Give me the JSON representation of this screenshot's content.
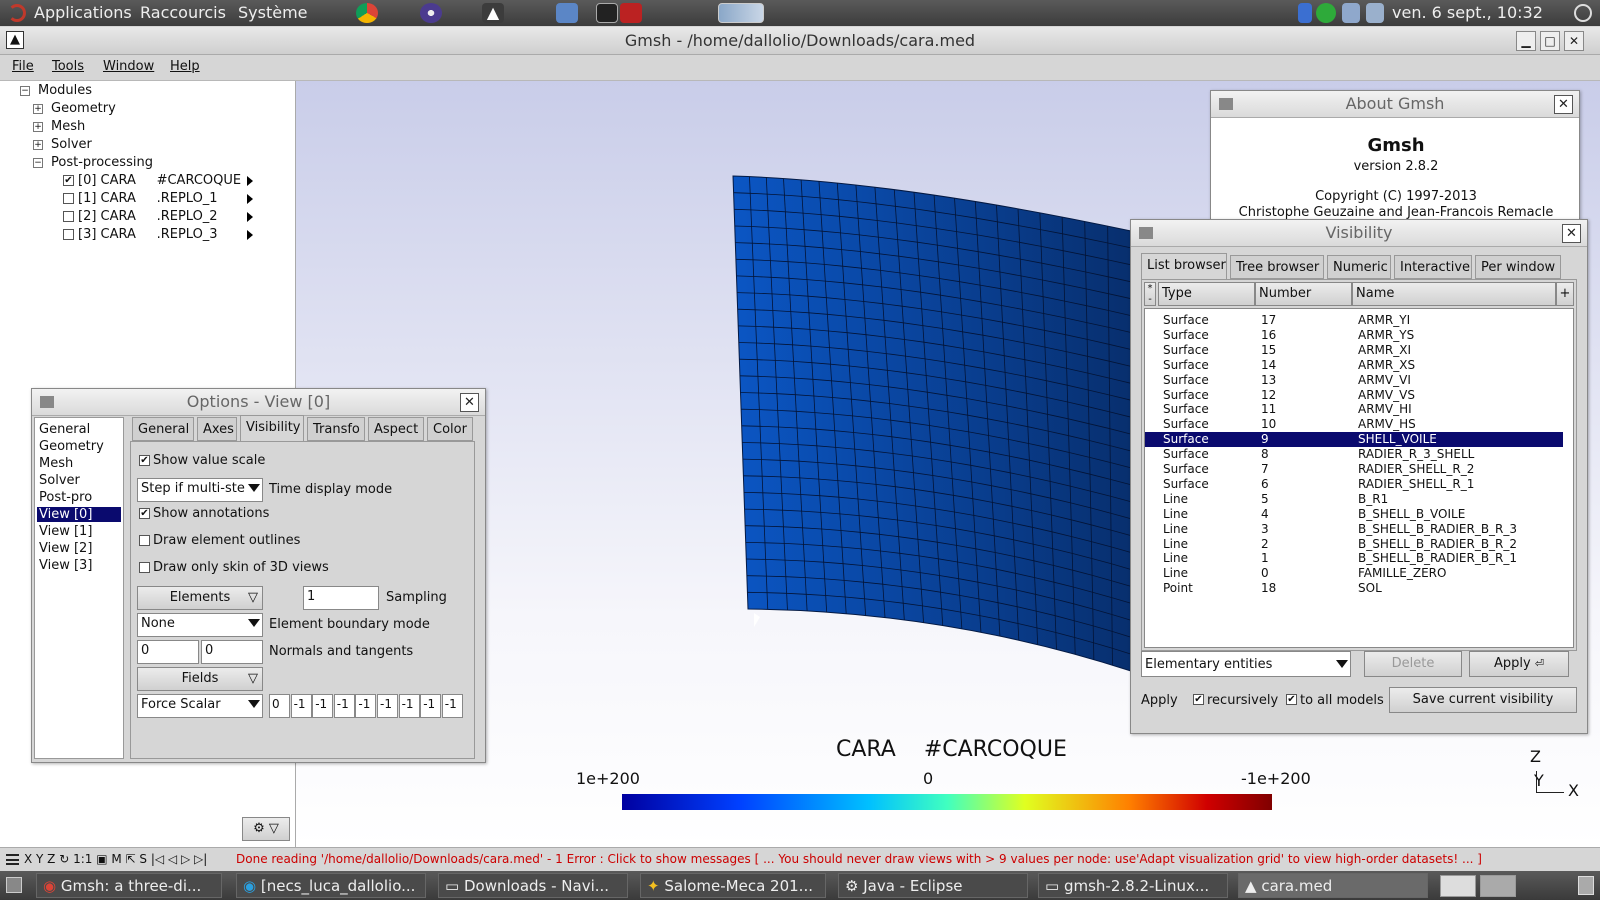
{
  "top_panel": {
    "applications": "Applications",
    "shortcuts": "Raccourcis",
    "system": "Système",
    "clock": "ven.  6 sept., 10:32"
  },
  "window": {
    "title": "Gmsh - /home/dallolio/Downloads/cara.med"
  },
  "menu": {
    "file": "File",
    "tools": "Tools",
    "window": "Window",
    "help": "Help"
  },
  "tree": {
    "modules": "Modules",
    "geometry": "Geometry",
    "mesh": "Mesh",
    "solver": "Solver",
    "postpro": "Post-processing",
    "views": [
      {
        "label": "[0] CARA     #CARCOQUE",
        "checked": true
      },
      {
        "label": "[1] CARA     .REPLO_1",
        "checked": false
      },
      {
        "label": "[2] CARA     .REPLO_2",
        "checked": false
      },
      {
        "label": "[3] CARA     .REPLO_3",
        "checked": false
      }
    ]
  },
  "about": {
    "title": "About Gmsh",
    "app": "Gmsh",
    "version": "version 2.8.2",
    "copyright": "Copyright (C) 1997-2013",
    "authors": "Christophe Geuzaine and Jean-Francois Remacle"
  },
  "options": {
    "title": "Options - View [0]",
    "categories": [
      "General",
      "Geometry",
      "Mesh",
      "Solver",
      "Post-pro",
      "View [0]",
      "View [1]",
      "View [2]",
      "View [3]"
    ],
    "tabs": [
      "General",
      "Axes",
      "Visibility",
      "Transfo",
      "Aspect",
      "Color"
    ],
    "show_value_scale": "Show value scale",
    "time_mode_value": "Step if multi-ste",
    "time_mode_label": "Time display mode",
    "show_annotations": "Show annotations",
    "draw_outlines": "Draw element outlines",
    "draw_skin": "Draw only skin of 3D views",
    "elements_btn": "Elements",
    "sampling_value": "1",
    "sampling_label": "Sampling",
    "boundary_value": "None",
    "boundary_label": "Element boundary mode",
    "normals_a": "0",
    "normals_b": "0",
    "normals_label": "Normals and tangents",
    "fields_btn": "Fields",
    "force_value": "Force Scalar",
    "force_fields": [
      "0",
      "-1",
      "-1",
      "-1",
      "-1",
      "-1",
      "-1",
      "-1",
      "-1"
    ]
  },
  "visibility": {
    "title": "Visibility",
    "tabs": [
      "List browser",
      "Tree browser",
      "Numeric",
      "Interactive",
      "Per window"
    ],
    "col_type": "Type",
    "col_number": "Number",
    "col_name": "Name",
    "plus": "+",
    "rows": [
      {
        "type": "Surface",
        "number": "17",
        "name": "ARMR_YI"
      },
      {
        "type": "Surface",
        "number": "16",
        "name": "ARMR_YS"
      },
      {
        "type": "Surface",
        "number": "15",
        "name": "ARMR_XI"
      },
      {
        "type": "Surface",
        "number": "14",
        "name": "ARMR_XS"
      },
      {
        "type": "Surface",
        "number": "13",
        "name": "ARMV_VI"
      },
      {
        "type": "Surface",
        "number": "12",
        "name": "ARMV_VS"
      },
      {
        "type": "Surface",
        "number": "11",
        "name": "ARMV_HI"
      },
      {
        "type": "Surface",
        "number": "10",
        "name": "ARMV_HS"
      },
      {
        "type": "Surface",
        "number": "9",
        "name": "SHELL_VOILE"
      },
      {
        "type": "Surface",
        "number": "8",
        "name": "RADIER_R_3_SHELL"
      },
      {
        "type": "Surface",
        "number": "7",
        "name": "RADIER_SHELL_R_2"
      },
      {
        "type": "Surface",
        "number": "6",
        "name": "RADIER_SHELL_R_1"
      },
      {
        "type": "Line",
        "number": "5",
        "name": "B_R1"
      },
      {
        "type": "Line",
        "number": "4",
        "name": "B_SHELL_B_VOILE"
      },
      {
        "type": "Line",
        "number": "3",
        "name": "B_SHELL_B_RADIER_B_R_3"
      },
      {
        "type": "Line",
        "number": "2",
        "name": "B_SHELL_B_RADIER_B_R_2"
      },
      {
        "type": "Line",
        "number": "1",
        "name": "B_SHELL_B_RADIER_B_R_1"
      },
      {
        "type": "Line",
        "number": "0",
        "name": "FAMILLE_ZERO"
      },
      {
        "type": "Point",
        "number": "18",
        "name": "SOL"
      }
    ],
    "selected_row": "9",
    "entities_value": "Elementary entities",
    "delete": "Delete",
    "apply": "Apply",
    "apply_label": "Apply",
    "recursively": "recursively",
    "to_all_models": "to all models",
    "save": "Save current visibility"
  },
  "scene": {
    "view_name": "CARA    #CARCOQUE",
    "scale_min": "1e+200",
    "scale_mid": "0",
    "scale_max": "-1e+200",
    "axis_z": "Z",
    "axis_y": "Y",
    "axis_x": "X"
  },
  "status": {
    "tools": "X Y Z ↻ 1:1 ▣ M ⇱ S |◁ ◁ ▷ ▷|",
    "message": "Done reading '/home/dallolio/Downloads/cara.med'  -  1 Error : Click to show messages [ ... You should never draw views with > 9 values per node: use'Adapt visualization grid' to view high-order datasets! ... ]"
  },
  "taskbar": [
    {
      "label": "Gmsh: a three-di..."
    },
    {
      "label": "[necs_luca_dallolio..."
    },
    {
      "label": "Downloads - Navi..."
    },
    {
      "label": "Salome-Meca 201..."
    },
    {
      "label": "Java - Eclipse"
    },
    {
      "label": "gmsh-2.8.2-Linux..."
    },
    {
      "label": "cara.med"
    }
  ],
  "colors": {
    "mesh": "#0a4fb8",
    "selection": "#0a0a6e",
    "error_text": "#cc0000"
  }
}
